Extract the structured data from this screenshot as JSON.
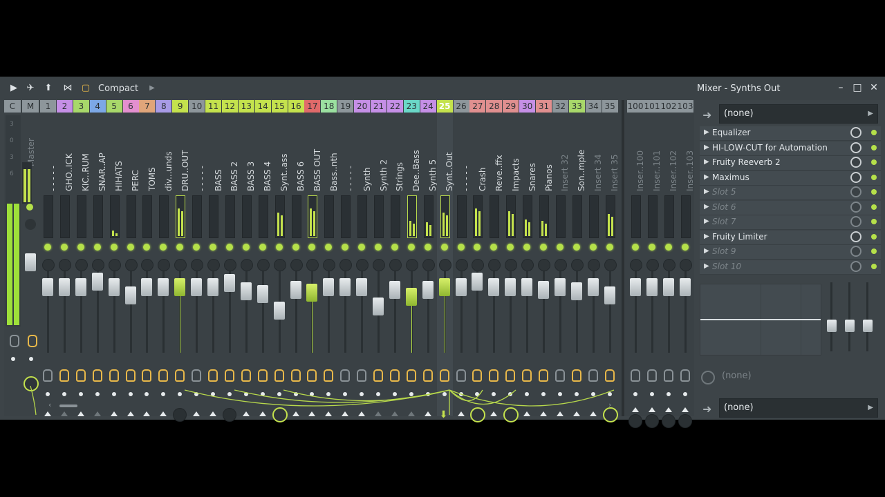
{
  "toolbar": {
    "compact_label": "Compact",
    "window_title": "Mixer - Synths Out"
  },
  "master": {
    "name": "Master",
    "cm": [
      "C",
      "M"
    ],
    "scale": [
      "3",
      "0",
      "3",
      "6"
    ]
  },
  "channels": [
    {
      "n": "1",
      "name": "- - - - -",
      "color": "#8d969b"
    },
    {
      "n": "2",
      "name": "GHO..ICK",
      "color": "#c58fe6"
    },
    {
      "n": "3",
      "name": "KIC..RUM",
      "color": "#a8d86a"
    },
    {
      "n": "4",
      "name": "SNAR..AP",
      "color": "#7ca8e6"
    },
    {
      "n": "5",
      "name": "HIHATS",
      "color": "#a8d86a"
    },
    {
      "n": "6",
      "name": "PERC",
      "color": "#e48fcf"
    },
    {
      "n": "7",
      "name": "TOMS",
      "color": "#e0a57a"
    },
    {
      "n": "8",
      "name": "div...unds",
      "color": "#a89be6"
    },
    {
      "n": "9",
      "name": "DRU..OUT",
      "color": "#c4e24d"
    },
    {
      "n": "10",
      "name": "- - - - -",
      "color": "#8d969b"
    },
    {
      "n": "11",
      "name": "BASS",
      "color": "#c4e24d"
    },
    {
      "n": "12",
      "name": "BASS 2",
      "color": "#c4e24d"
    },
    {
      "n": "13",
      "name": "BASS 3",
      "color": "#c4e24d"
    },
    {
      "n": "14",
      "name": "BASS 4",
      "color": "#c4e24d"
    },
    {
      "n": "15",
      "name": "Synt..ass",
      "color": "#c4e24d"
    },
    {
      "n": "16",
      "name": "BASS 6",
      "color": "#c4e24d"
    },
    {
      "n": "17",
      "name": "BASS OUT",
      "color": "#e06a6a"
    },
    {
      "n": "18",
      "name": "Bass..nth",
      "color": "#9be0a0"
    },
    {
      "n": "19",
      "name": "- - - - -",
      "color": "#8d969b"
    },
    {
      "n": "20",
      "name": "Synth",
      "color": "#c58fe6"
    },
    {
      "n": "21",
      "name": "Synth 2",
      "color": "#c58fe6"
    },
    {
      "n": "22",
      "name": "Strings",
      "color": "#c58fe6"
    },
    {
      "n": "23",
      "name": "Dee..Bass",
      "color": "#6ad8c8"
    },
    {
      "n": "24",
      "name": "Synth 5",
      "color": "#c58fe6"
    },
    {
      "n": "25",
      "name": "Synt..Out",
      "color": "#c4e24d"
    },
    {
      "n": "26",
      "name": "- - - - -",
      "color": "#8d969b"
    },
    {
      "n": "27",
      "name": "Crash",
      "color": "#e08f8f"
    },
    {
      "n": "28",
      "name": "Reve..ffx",
      "color": "#e08f8f"
    },
    {
      "n": "29",
      "name": "Impacts",
      "color": "#e08f8f"
    },
    {
      "n": "30",
      "name": "Snares",
      "color": "#c58fe6"
    },
    {
      "n": "31",
      "name": "Pianos",
      "color": "#e08f8f"
    },
    {
      "n": "32",
      "name": "Insert 32",
      "color": "#8d969b"
    },
    {
      "n": "33",
      "name": "Son..mple",
      "color": "#a8d86a"
    },
    {
      "n": "34",
      "name": "Insert 34",
      "color": "#8d969b"
    },
    {
      "n": "35",
      "name": "Insert 35",
      "color": "#8d969b"
    }
  ],
  "extra_channels": [
    {
      "n": "100",
      "name": "Inser..100"
    },
    {
      "n": "101",
      "name": "Inser..101"
    },
    {
      "n": "102",
      "name": "Inser..102"
    },
    {
      "n": "103",
      "name": "Inser..103"
    }
  ],
  "panel": {
    "input": "(none)",
    "slots": [
      {
        "name": "Equalizer",
        "empty": false
      },
      {
        "name": "HI-LOW-CUT for Automation",
        "empty": false
      },
      {
        "name": "Fruity Reeverb 2",
        "empty": false
      },
      {
        "name": "Maximus",
        "empty": false
      },
      {
        "name": "Slot 5",
        "empty": true
      },
      {
        "name": "Slot 6",
        "empty": true
      },
      {
        "name": "Slot 7",
        "empty": true
      },
      {
        "name": "Fruity Limiter",
        "empty": false
      },
      {
        "name": "Slot 9",
        "empty": true
      },
      {
        "name": "Slot 10",
        "empty": true
      }
    ],
    "time_label": "(none)",
    "output": "(none)"
  }
}
